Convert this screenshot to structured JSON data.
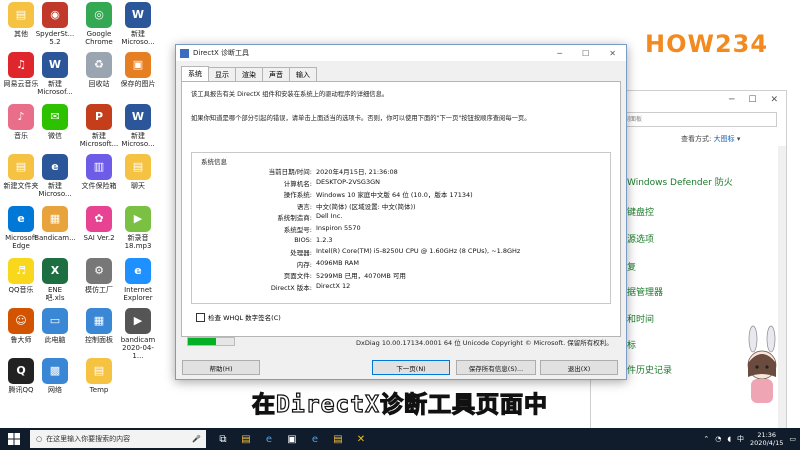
{
  "desktop_icons": [
    {
      "label": "其他",
      "color": "#f5c242",
      "glyph": "▤"
    },
    {
      "label": "SpyderSt...\n5.2",
      "color": "#c0392b",
      "glyph": "◉"
    },
    {
      "label": "Google\nChrome",
      "color": "#34a853",
      "glyph": "◎"
    },
    {
      "label": "新建\nMicroso...",
      "color": "#2b579a",
      "glyph": "W"
    },
    {
      "label": "网易云音乐",
      "color": "#e0262d",
      "glyph": "♫"
    },
    {
      "label": "新建\nMicrosof...",
      "color": "#2b579a",
      "glyph": "W"
    },
    {
      "label": "回收站",
      "color": "#9aa5b1",
      "glyph": "♻"
    },
    {
      "label": "保存的图片",
      "color": "#e67e22",
      "glyph": "▣"
    },
    {
      "label": "音乐",
      "color": "#e96e8a",
      "glyph": "♪"
    },
    {
      "label": "微信",
      "color": "#2dc100",
      "glyph": "✉"
    },
    {
      "label": "新建\nMicrosoft...",
      "color": "#c43e1c",
      "glyph": "P"
    },
    {
      "label": "新建\nMicroso...",
      "color": "#2b579a",
      "glyph": "W"
    },
    {
      "label": "新建文件夹",
      "color": "#f5c242",
      "glyph": "▤"
    },
    {
      "label": "新建\nMicroso...",
      "color": "#2b579a",
      "glyph": "e"
    },
    {
      "label": "文件保险箱",
      "color": "#6c5ce7",
      "glyph": "▥"
    },
    {
      "label": "聊天",
      "color": "#f5c242",
      "glyph": "▤"
    },
    {
      "label": "Microsoft\nEdge",
      "color": "#0078d7",
      "glyph": "e"
    },
    {
      "label": "Bandicam...",
      "color": "#e8a33d",
      "glyph": "▦"
    },
    {
      "label": "SAI Ver.2",
      "color": "#e84393",
      "glyph": "✿"
    },
    {
      "label": "新录音\n18.mp3",
      "color": "#7ac143",
      "glyph": "▶"
    },
    {
      "label": "QQ音乐",
      "color": "#f9d71c",
      "glyph": "♬"
    },
    {
      "label": "ENE\n吧.xls",
      "color": "#1d6f42",
      "glyph": "X"
    },
    {
      "label": "模仿工厂",
      "color": "#777",
      "glyph": "⚙"
    },
    {
      "label": "Internet\nExplorer",
      "color": "#1e90ff",
      "glyph": "e"
    },
    {
      "label": "鲁大师",
      "color": "#d35400",
      "glyph": "☺"
    },
    {
      "label": "此电脑",
      "color": "#3a87d6",
      "glyph": "▭"
    },
    {
      "label": "控制面板",
      "color": "#3a87d6",
      "glyph": "▦"
    },
    {
      "label": "bandicam\n2020-04-1...",
      "color": "#555",
      "glyph": "▶"
    },
    {
      "label": "腾讯QQ",
      "color": "#222",
      "glyph": "Q"
    },
    {
      "label": "网络",
      "color": "#3a87d6",
      "glyph": "▩"
    },
    {
      "label": "Temp",
      "color": "#f5c242",
      "glyph": "▤"
    }
  ],
  "logo": "HOW234",
  "control_panel": {
    "search_placeholder": "搜索控制面板",
    "view_label": "查看方式:",
    "view_value": "大图标",
    "links": [
      "Windows Defender 防火",
      "键盘控",
      "源选项",
      "复",
      "据管理器",
      "和时间",
      "标",
      "件历史记录"
    ]
  },
  "dialog": {
    "title": "DirectX 诊断工具",
    "tabs": [
      "系统",
      "显示",
      "渲染",
      "声音",
      "输入"
    ],
    "active_tab": 0,
    "intro1": "该工具报告有关 DirectX 组件和安装在系统上的驱动程序的详细信息。",
    "intro2": "如果你知道是哪个部分引起的错误，请单击上面适当的选项卡。否则，你可以使用下面的\"下一页\"按钮按顺序查阅每一页。",
    "sysinfo_legend": "系统信息",
    "rows": [
      {
        "k": "当前日期/时间:",
        "v": "2020年4月15日, 21:36:08"
      },
      {
        "k": "计算机名:",
        "v": "DESKTOP-2VSG3GN"
      },
      {
        "k": "操作系统:",
        "v": "Windows 10 家庭中文版 64 位 (10.0，版本 17134)"
      },
      {
        "k": "语言:",
        "v": "中文(简体) (区域设置: 中文(简体))"
      },
      {
        "k": "系统制造商:",
        "v": "Dell Inc."
      },
      {
        "k": "系统型号:",
        "v": "Inspiron 5570"
      },
      {
        "k": "BIOS:",
        "v": "1.2.3"
      },
      {
        "k": "处理器:",
        "v": "Intel(R) Core(TM) i5-8250U CPU @ 1.60GHz (8 CPUs), ~1.8GHz"
      },
      {
        "k": "内存:",
        "v": "4096MB RAM"
      },
      {
        "k": "页面文件:",
        "v": "5299MB 已用，4070MB 可用"
      },
      {
        "k": "DirectX 版本:",
        "v": "DirectX 12"
      }
    ],
    "whql_label": "检查 WHQL 数字签名(C)",
    "progress": 0.6,
    "footer": "DxDiag 10.00.17134.0001 64 位 Unicode  Copyright © Microsoft. 保留所有权利。",
    "buttons": {
      "help": "帮助(H)",
      "next": "下一页(N)",
      "save": "保存所有信息(S)...",
      "exit": "退出(X)"
    }
  },
  "subtitle": "在DirectX诊断工具页面中",
  "taskbar": {
    "search_placeholder": "在这里输入你要搜索的内容",
    "clock_time": "21:36",
    "clock_date": "2020/4/15",
    "ime": "中"
  }
}
